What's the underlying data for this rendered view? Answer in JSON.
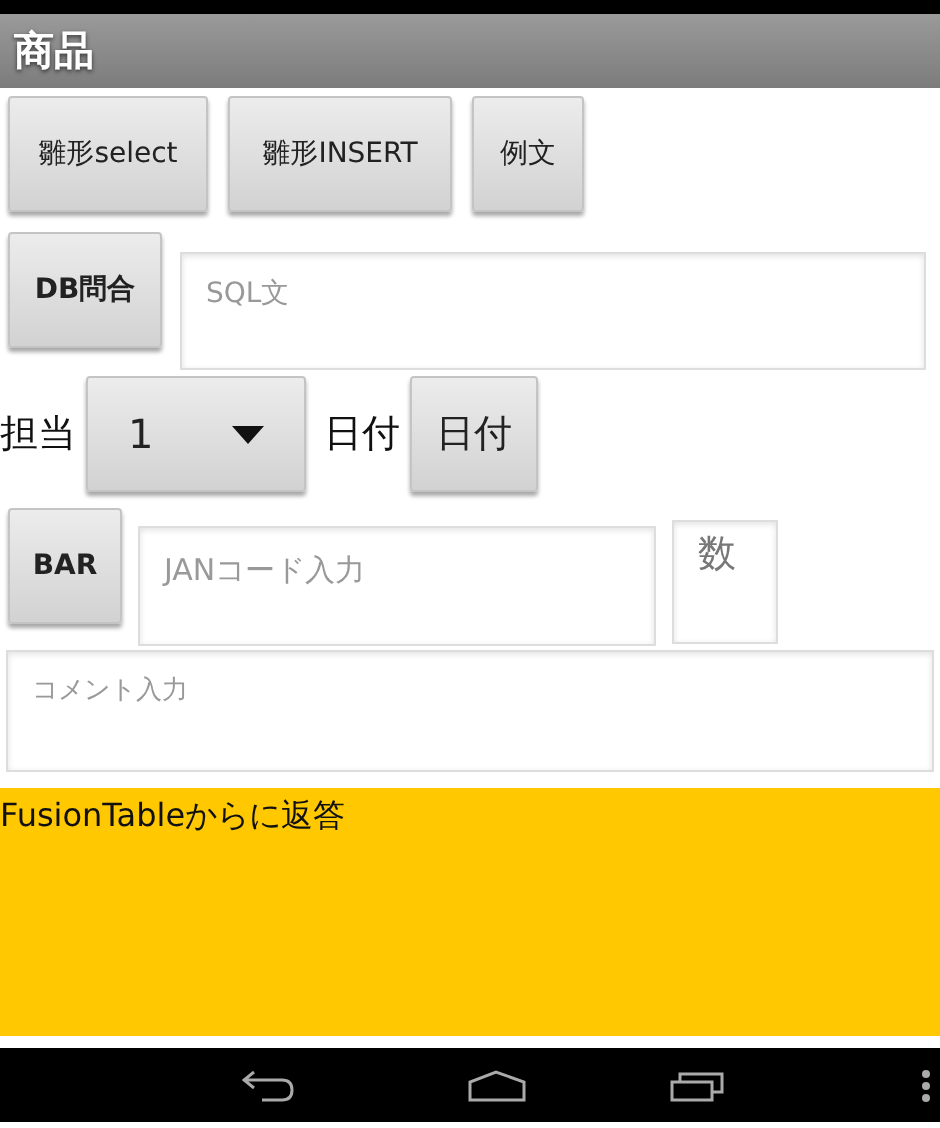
{
  "title": "商品",
  "template_buttons": [
    {
      "label": "雛形select"
    },
    {
      "label": "雛形INSERT"
    },
    {
      "label": "例文"
    }
  ],
  "query": {
    "button": "DB問合",
    "placeholder": "SQL文"
  },
  "staff": {
    "label": "担当",
    "value": "1",
    "date_label": "日付",
    "date_button": "日付"
  },
  "barcode": {
    "button": "BAR",
    "placeholder": "JANコード入力",
    "quantity_placeholder": "数"
  },
  "comment": {
    "placeholder": "コメント入力"
  },
  "response": {
    "text": "FusionTableからに返答"
  }
}
